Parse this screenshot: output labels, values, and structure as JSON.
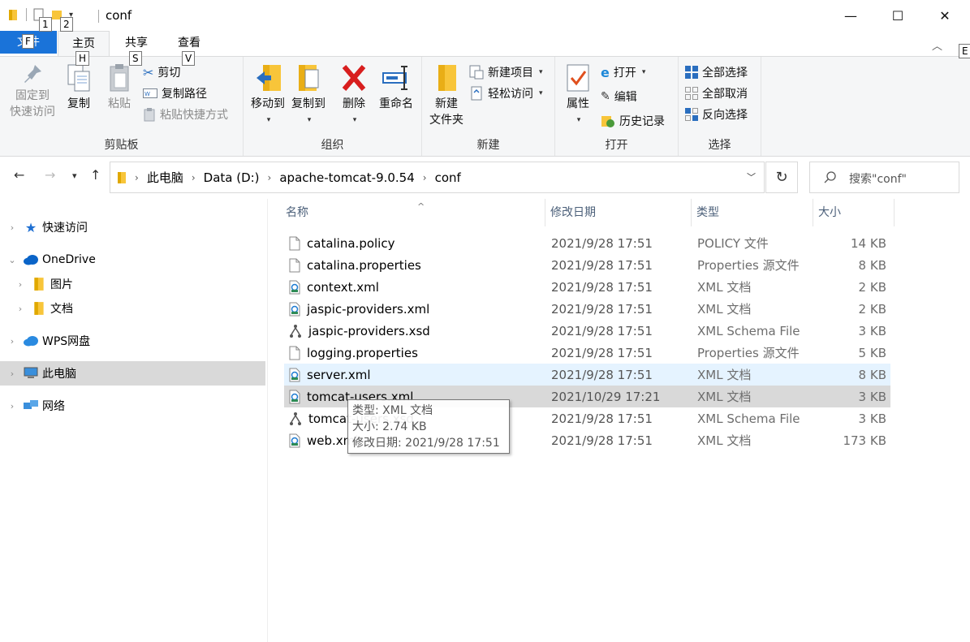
{
  "titlebar": {
    "title": "conf",
    "minimize": "—",
    "maximize": "☐",
    "close": "✕"
  },
  "keytips": {
    "qat1": "1",
    "qat2": "2",
    "file": "F",
    "home": "H",
    "share": "S",
    "view": "V",
    "extra": "E"
  },
  "tabs": {
    "file": "文件",
    "home": "主页",
    "share": "共享",
    "view": "查看"
  },
  "ribbon": {
    "clipboard": {
      "label": "剪贴板",
      "pin": "固定到\n快速访问",
      "copy": "复制",
      "paste": "粘贴",
      "cut": "剪切",
      "copy_path": "复制路径",
      "paste_shortcut": "粘贴快捷方式"
    },
    "organize": {
      "label": "组织",
      "move_to": "移动到",
      "copy_to": "复制到",
      "delete": "删除",
      "rename": "重命名"
    },
    "new": {
      "label": "新建",
      "new_folder": "新建\n文件夹",
      "new_item": "新建项目",
      "easy_access": "轻松访问"
    },
    "open": {
      "label": "打开",
      "properties": "属性",
      "open": "打开",
      "edit": "编辑",
      "history": "历史记录"
    },
    "select": {
      "label": "选择",
      "select_all": "全部选择",
      "select_none": "全部取消",
      "invert": "反向选择"
    }
  },
  "address": {
    "crumbs": [
      "此电脑",
      "Data (D:)",
      "apache-tomcat-9.0.54",
      "conf"
    ],
    "search_placeholder": "搜索\"conf\""
  },
  "nav": {
    "quick_access": "快速访问",
    "onedrive": "OneDrive",
    "pictures": "图片",
    "documents": "文档",
    "wps": "WPS网盘",
    "this_pc": "此电脑",
    "network": "网络"
  },
  "columns": {
    "name": "名称",
    "date": "修改日期",
    "type": "类型",
    "size": "大小"
  },
  "files": [
    {
      "name": "catalina.policy",
      "date": "2021/9/28 17:51",
      "type": "POLICY 文件",
      "size": "14 KB",
      "icon": "doc-icon"
    },
    {
      "name": "catalina.properties",
      "date": "2021/9/28 17:51",
      "type": "Properties 源文件",
      "size": "8 KB",
      "icon": "doc-icon"
    },
    {
      "name": "context.xml",
      "date": "2021/9/28 17:51",
      "type": "XML 文档",
      "size": "2 KB",
      "icon": "xml-icon"
    },
    {
      "name": "jaspic-providers.xml",
      "date": "2021/9/28 17:51",
      "type": "XML 文档",
      "size": "2 KB",
      "icon": "xml-icon"
    },
    {
      "name": "jaspic-providers.xsd",
      "date": "2021/9/28 17:51",
      "type": "XML Schema File",
      "size": "3 KB",
      "icon": "xsd-icon"
    },
    {
      "name": "logging.properties",
      "date": "2021/9/28 17:51",
      "type": "Properties 源文件",
      "size": "5 KB",
      "icon": "doc-icon"
    },
    {
      "name": "server.xml",
      "date": "2021/9/28 17:51",
      "type": "XML 文档",
      "size": "8 KB",
      "icon": "xml-icon"
    },
    {
      "name": "tomcat-users.xml",
      "date": "2021/10/29 17:21",
      "type": "XML 文档",
      "size": "3 KB",
      "icon": "xml-icon"
    },
    {
      "name": "tomcat-users.xsd",
      "date": "2021/9/28 17:51",
      "type": "XML Schema File",
      "size": "3 KB",
      "icon": "xsd-icon"
    },
    {
      "name": "web.xml",
      "date": "2021/9/28 17:51",
      "type": "XML 文档",
      "size": "173 KB",
      "icon": "xml-icon"
    }
  ],
  "tooltip": {
    "type": "类型: XML 文档",
    "size": "大小: 2.74 KB",
    "date": "修改日期: 2021/9/28 17:51"
  },
  "colors": {
    "accent": "#1a73d9",
    "folder": "#f8c53a",
    "hover_row": "#e5f3ff",
    "selected_row": "#d9d9d9"
  }
}
